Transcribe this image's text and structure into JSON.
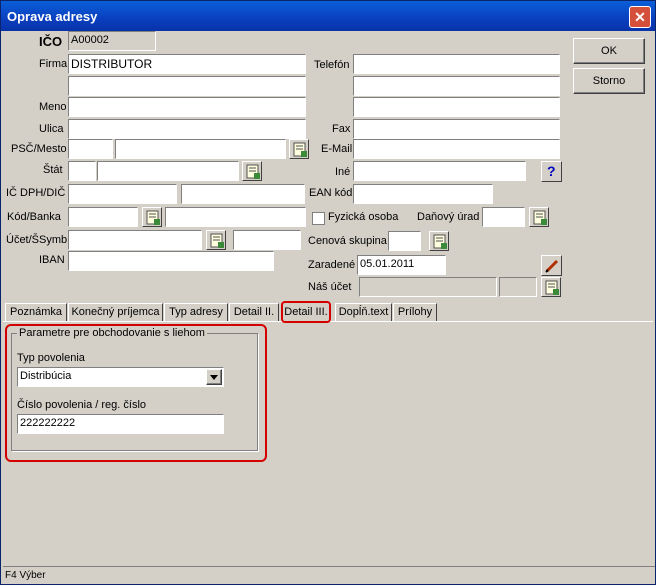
{
  "window": {
    "title": "Oprava adresy"
  },
  "buttons": {
    "ok": "OK",
    "storno": "Storno"
  },
  "form": {
    "ico_label": "IČO",
    "ico_value": "A00002",
    "firma_label": "Firma",
    "firma_value": "DISTRIBUTOR",
    "meno_label": "Meno",
    "ulica_label": "Ulica",
    "psc_label": "PSČ/Mesto",
    "stat_label": "Štát",
    "icdph_label": "IČ DPH/DIČ",
    "kod_label": "Kód/Banka",
    "ucet_label": "Účet/ŠSymb",
    "iban_label": "IBAN",
    "telefon_label": "Telefón",
    "fax_label": "Fax",
    "email_label": "E-Mail",
    "ine_label": "Iné",
    "ean_label": "EAN kód",
    "fyzicka_label": "Fyzická osoba",
    "danovy_label": "Daňový úrad",
    "cenova_label": "Cenová skupina",
    "zaradene_label": "Zaradené",
    "zaradene_value": "05.01.2011",
    "nas_ucet_label": "Náš účet"
  },
  "tabs": [
    "Poznámka",
    "Konečný príjemca",
    "Typ adresy",
    "Detail II.",
    "Detail III.",
    "Dopĺň.text",
    "Prílohy"
  ],
  "panel": {
    "group_title": "Parametre pre obchodovanie s liehom",
    "typ_label": "Typ povolenia",
    "typ_value": "Distribúcia",
    "cislo_label": "Číslo povolenia / reg. číslo",
    "cislo_value": "222222222"
  },
  "status": {
    "text": "F4 Výber"
  },
  "colors": {
    "highlight": "#d40000",
    "titlebar": "#0a4fd0"
  }
}
